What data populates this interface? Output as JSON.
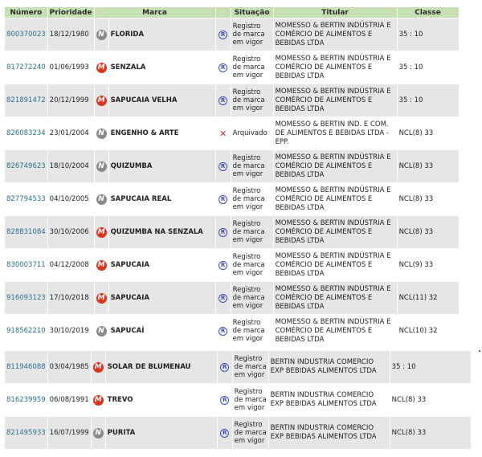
{
  "headers": {
    "numero": "Número",
    "prioridade": "Prioridade",
    "marca": "Marca",
    "situacao": "Situação",
    "titular": "Titular",
    "classe": "Classe"
  },
  "rows1": [
    {
      "numero": "800370023",
      "prioridade": "18/12/1980",
      "badge": "N",
      "marca": "FLORIDA",
      "status_icon": "registered",
      "situacao": "Registro de marca em vigor",
      "titular": "MOMESSO & BERTIN INDÚSTRIA E COMÉRCIO DE ALIMENTOS E BEBIDAS LTDA",
      "classe": "35 : 10"
    },
    {
      "numero": "817272240",
      "prioridade": "01/06/1993",
      "badge": "M",
      "marca": "SENZALA",
      "status_icon": "registered",
      "situacao": "Registro de marca em vigor",
      "titular": "MOMESSO & BERTIN INDÚSTRIA E COMÉRCIO DE ALIMENTOS E BEBIDAS LTDA",
      "classe": "35 : 10"
    },
    {
      "numero": "821891472",
      "prioridade": "20/12/1999",
      "badge": "M",
      "marca": "SAPUCAIA VELHA",
      "status_icon": "registered",
      "situacao": "Registro de marca em vigor",
      "titular": "MOMESSO & BERTIN INDÚSTRIA E COMÉRCIO DE ALIMENTOS E BEBIDAS LTDA",
      "classe": "35 : 10"
    },
    {
      "numero": "826083234",
      "prioridade": "23/01/2004",
      "badge": "N",
      "marca": "ENGENHO & ARTE",
      "status_icon": "archived",
      "situacao": "Arquivado",
      "titular": "MOMESSO & BERTIN IND. E COM. DE ALIMENTOS E BEBIDAS LTDA - EPP.",
      "classe": "NCL(8) 33"
    },
    {
      "numero": "826749623",
      "prioridade": "18/10/2004",
      "badge": "N",
      "marca": "QUIZUMBA",
      "status_icon": "registered",
      "situacao": "Registro de marca em vigor",
      "titular": "MOMESSO & BERTIN INDÚSTRIA E COMÉRCIO DE ALIMENTOS E BEBIDAS LTDA",
      "classe": "NCL(8) 33"
    },
    {
      "numero": "827794533",
      "prioridade": "04/10/2005",
      "badge": "N",
      "marca": "SAPUCAIA REAL",
      "status_icon": "registered",
      "situacao": "Registro de marca em vigor",
      "titular": "MOMESSO & BERTIN INDÚSTRIA E COMÉRCIO DE ALIMENTOS E BEBIDAS LTDA",
      "classe": "NCL(8) 33"
    },
    {
      "numero": "828831084",
      "prioridade": "30/10/2006",
      "badge": "M",
      "marca": "QUIZUMBA NA SENZALA",
      "status_icon": "registered",
      "situacao": "Registro de marca em vigor",
      "titular": "MOMESSO & BERTIN INDÚSTRIA E COMÉRCIO DE ALIMENTOS E BEBIDAS LTDA",
      "classe": "NCL(8) 33"
    },
    {
      "numero": "830003711",
      "prioridade": "04/12/2008",
      "badge": "M",
      "marca": "SAPUCAIA",
      "status_icon": "registered",
      "situacao": "Registro de marca em vigor",
      "titular": "MOMESSO & BERTIN INDÚSTRIA E COMÉRCIO DE ALIMENTOS E BEBIDAS LTDA",
      "classe": "NCL(9) 33"
    },
    {
      "numero": "916093123",
      "prioridade": "17/10/2018",
      "badge": "M",
      "marca": "SAPUCAIA",
      "status_icon": "registered",
      "situacao": "Registro de marca em vigor",
      "titular": "MOMESSO & BERTIN INDÚSTRIA E COMÉRCIO DE ALIMENTOS E BEBIDAS LTDA",
      "classe": "NCL(11) 32"
    },
    {
      "numero": "918562210",
      "prioridade": "30/10/2019",
      "badge": "N",
      "marca": "SAPUCAÍ",
      "status_icon": "registered",
      "situacao": "Registro de marca em vigor",
      "titular": "MOMESSO & BERTIN INDÚSTRIA E COMÉRCIO DE ALIMENTOS E BEBIDAS LTDA",
      "classe": "NCL(10) 32"
    }
  ],
  "rows2": [
    {
      "numero": "811946088",
      "prioridade": "03/04/1985",
      "badge": "M",
      "marca": "SOLAR DE BLUMENAU",
      "status_icon": "registered",
      "situacao": "Registro de marca em vigor",
      "titular": "BERTIN INDUSTRIA COMERCIO EXP BEBIDAS ALIMENTOS LTDA",
      "classe": "35 : 10"
    },
    {
      "numero": "816239959",
      "prioridade": "06/08/1991",
      "badge": "M",
      "marca": "TREVO",
      "status_icon": "registered",
      "situacao": "Registro de marca em vigor",
      "titular": "BERTIN INDUSTRIA COMERCIO EXP BEBIDAS ALIMENTOS LTDA",
      "classe": "NCL(8) 33"
    },
    {
      "numero": "821495933",
      "prioridade": "16/07/1999",
      "badge": "N",
      "marca": "PURITA",
      "status_icon": "registered",
      "situacao": "Registro de marca em vigor",
      "titular": "BERTIN INDUSTRIA COMERCIO EXP BEBIDAS ALIMENTOS LTDA",
      "classe": "NCL(8) 33"
    }
  ],
  "icons": {
    "registered": "registered-symbol-icon",
    "archived": "x-archived-icon",
    "N": "nominative-badge-icon",
    "M": "mixed-badge-icon"
  },
  "colors": {
    "header_bg": "#c7e0b3",
    "alt_row": "#e6e6e6",
    "link": "#2a6f8f",
    "badge_m": "#d9351f",
    "badge_n": "#8a8a8a"
  }
}
